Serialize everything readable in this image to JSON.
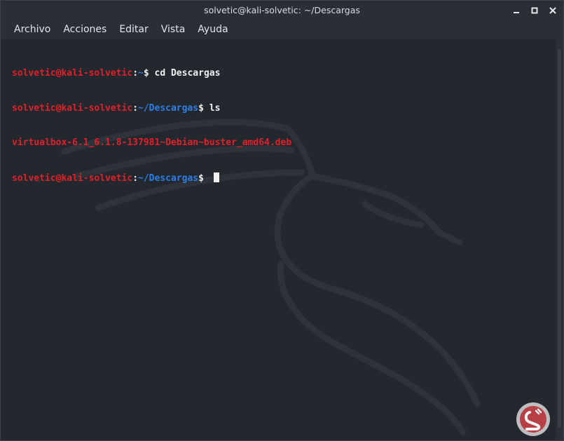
{
  "window": {
    "title": "solvetic@kali-solvetic: ~/Descargas"
  },
  "menu": {
    "items": [
      "Archivo",
      "Acciones",
      "Editar",
      "Vista",
      "Ayuda"
    ]
  },
  "terminal": {
    "line1": {
      "user": "solvetic@kali-solvetic",
      "sep": ":",
      "path": "~",
      "prompt": "$ ",
      "cmd": "cd Descargas"
    },
    "line2": {
      "user": "solvetic@kali-solvetic",
      "sep": ":",
      "path": "~/Descargas",
      "prompt": "$ ",
      "cmd": "ls"
    },
    "line3": {
      "file": "virtualbox-6.1_6.1.8-137981~Debian~buster_amd64.deb"
    },
    "line4": {
      "user": "solvetic@kali-solvetic",
      "sep": ":",
      "path": "~/Descargas",
      "prompt": "$ "
    }
  },
  "colors": {
    "background": "#23272e",
    "user": "#e0202a",
    "path": "#2f7ee6",
    "text": "#f0f0f0"
  },
  "icons": {
    "minimize": "minimize-icon",
    "maximize": "maximize-icon",
    "close": "close-icon",
    "watermark": "watermark-logo-icon"
  }
}
